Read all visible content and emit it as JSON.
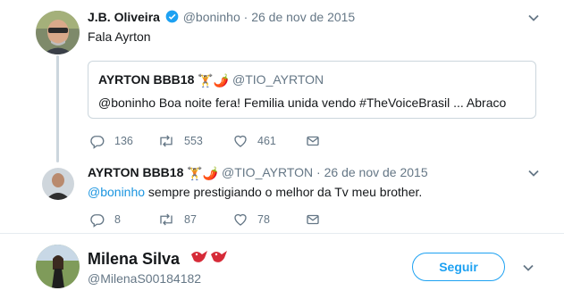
{
  "tweet1": {
    "name": "J.B. Oliveira",
    "handle": "@boninho",
    "separator": "·",
    "date": "26 de nov de 2015",
    "text": "Fala Ayrton",
    "quote": {
      "name": "AYRTON BBB18",
      "handle": "@TIO_AYRTON",
      "text": "@boninho Boa noite fera! Femilia unida vendo #TheVoiceBrasil ... Abraco"
    },
    "replies": "136",
    "retweets": "553",
    "likes": "461"
  },
  "tweet2": {
    "name": "AYRTON BBB18",
    "handle": "@TIO_AYRTON",
    "separator": "·",
    "date": "26 de nov de 2015",
    "mention": "@boninho",
    "text": " sempre prestigiando o melhor da Tv meu brother.",
    "replies": "8",
    "retweets": "87",
    "likes": "78"
  },
  "profile": {
    "name": "Milena Silva",
    "handle": "@MilenaS00184182",
    "follow_label": "Seguir"
  },
  "colors": {
    "accent": "#1da1f2",
    "muted": "#657786",
    "border": "#ccd6dd"
  },
  "icons": [
    "verified-icon",
    "reply-icon",
    "retweet-icon",
    "like-icon",
    "dm-icon",
    "chevron-down-icon",
    "weightlifter-emoji",
    "chili-emoji",
    "bird-emoji"
  ]
}
